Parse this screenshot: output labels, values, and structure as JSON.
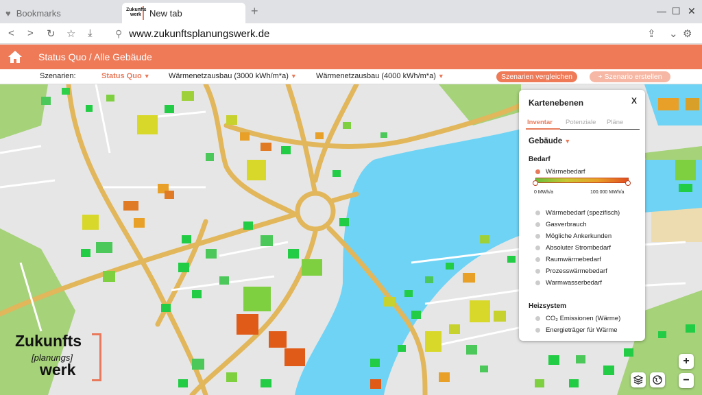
{
  "browser": {
    "tabs": [
      {
        "label": "Bookmarks",
        "icon": "heart-icon"
      },
      {
        "label": "New tab",
        "icon": "site-logo-icon",
        "logo_line1": "Zukunfts",
        "logo_line2": "werk"
      }
    ],
    "url": "www.zukunftsplanungswerk.de"
  },
  "header": {
    "breadcrumb": "Status Quo / Alle Gebäude"
  },
  "scenarios": {
    "label": "Szenarien:",
    "items": [
      "Status Quo",
      "Wärmenetzausbau (3000 kWh/m*a)",
      "Wärmenetzausbau (4000 kWh/m*a)"
    ],
    "compare_button": "Szenarien vergleichen",
    "create_button": "+ Szenario erstellen"
  },
  "panel": {
    "title": "Kartenebenen",
    "close": "X",
    "tabs": [
      "Inventar",
      "Potenziale",
      "Pläne"
    ],
    "active_tab": "Inventar",
    "dropdown": "Gebäude",
    "sections": [
      {
        "heading": "Bedarf",
        "active_layer": "Wärmebedarf",
        "scale_min": "0 MWh/a",
        "scale_max": "100.000 MWh/a",
        "layers": [
          "Wärmebedarf (spezifisch)",
          "Gasverbrauch",
          "Mögliche Ankerkunden",
          "Absoluter Strombedarf",
          "Raumwärmebedarf",
          "Prozesswärmebedarf",
          "Warmwasserbedarf"
        ]
      },
      {
        "heading": "Heizsystem",
        "layers": [
          "CO₂ Emissionen (Wärme)",
          "Energieträger für Wärme"
        ]
      }
    ]
  },
  "logo": {
    "line1": "Zukunfts",
    "line2": "[planungs]",
    "line3": "werk"
  },
  "controls": {
    "zoom_in": "+",
    "zoom_out": "−"
  },
  "colors": {
    "accent": "#ee7a58",
    "water": "#6fd3f5",
    "road": "#e2b65a",
    "park": "#a6d27a"
  }
}
